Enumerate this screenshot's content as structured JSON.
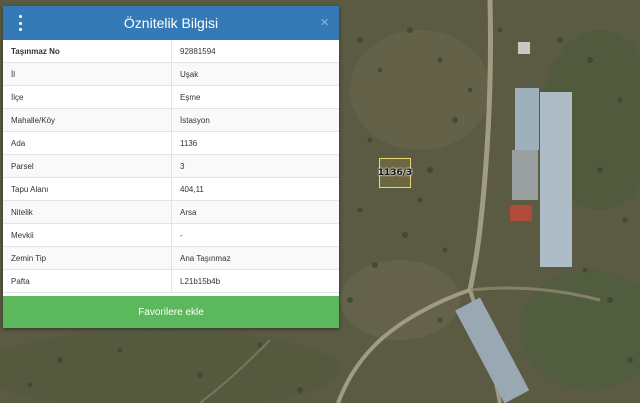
{
  "panel": {
    "title": "Öznitelik Bilgisi",
    "close_symbol": "×",
    "menu_icon": "vertical-dots-icon",
    "rows": [
      {
        "key": "Taşınmaz No",
        "value": "92881594"
      },
      {
        "key": "İl",
        "value": "Uşak"
      },
      {
        "key": "İlçe",
        "value": "Eşme"
      },
      {
        "key": "Mahalle/Köy",
        "value": "İstasyon"
      },
      {
        "key": "Ada",
        "value": "1136"
      },
      {
        "key": "Parsel",
        "value": "3"
      },
      {
        "key": "Tapu Alanı",
        "value": "404,11"
      },
      {
        "key": "Nitelik",
        "value": "Arsa"
      },
      {
        "key": "Mevkii",
        "value": "-"
      },
      {
        "key": "Zemin Tip",
        "value": "Ana Taşınmaz"
      },
      {
        "key": "Pafta",
        "value": "L21b15b4b"
      }
    ],
    "favorite_button": "Favorilere ekle"
  },
  "map": {
    "parcel_label": "1136/3"
  },
  "colors": {
    "header": "#337ab7",
    "button": "#5cb85c",
    "terrain": "#5d5c44"
  }
}
